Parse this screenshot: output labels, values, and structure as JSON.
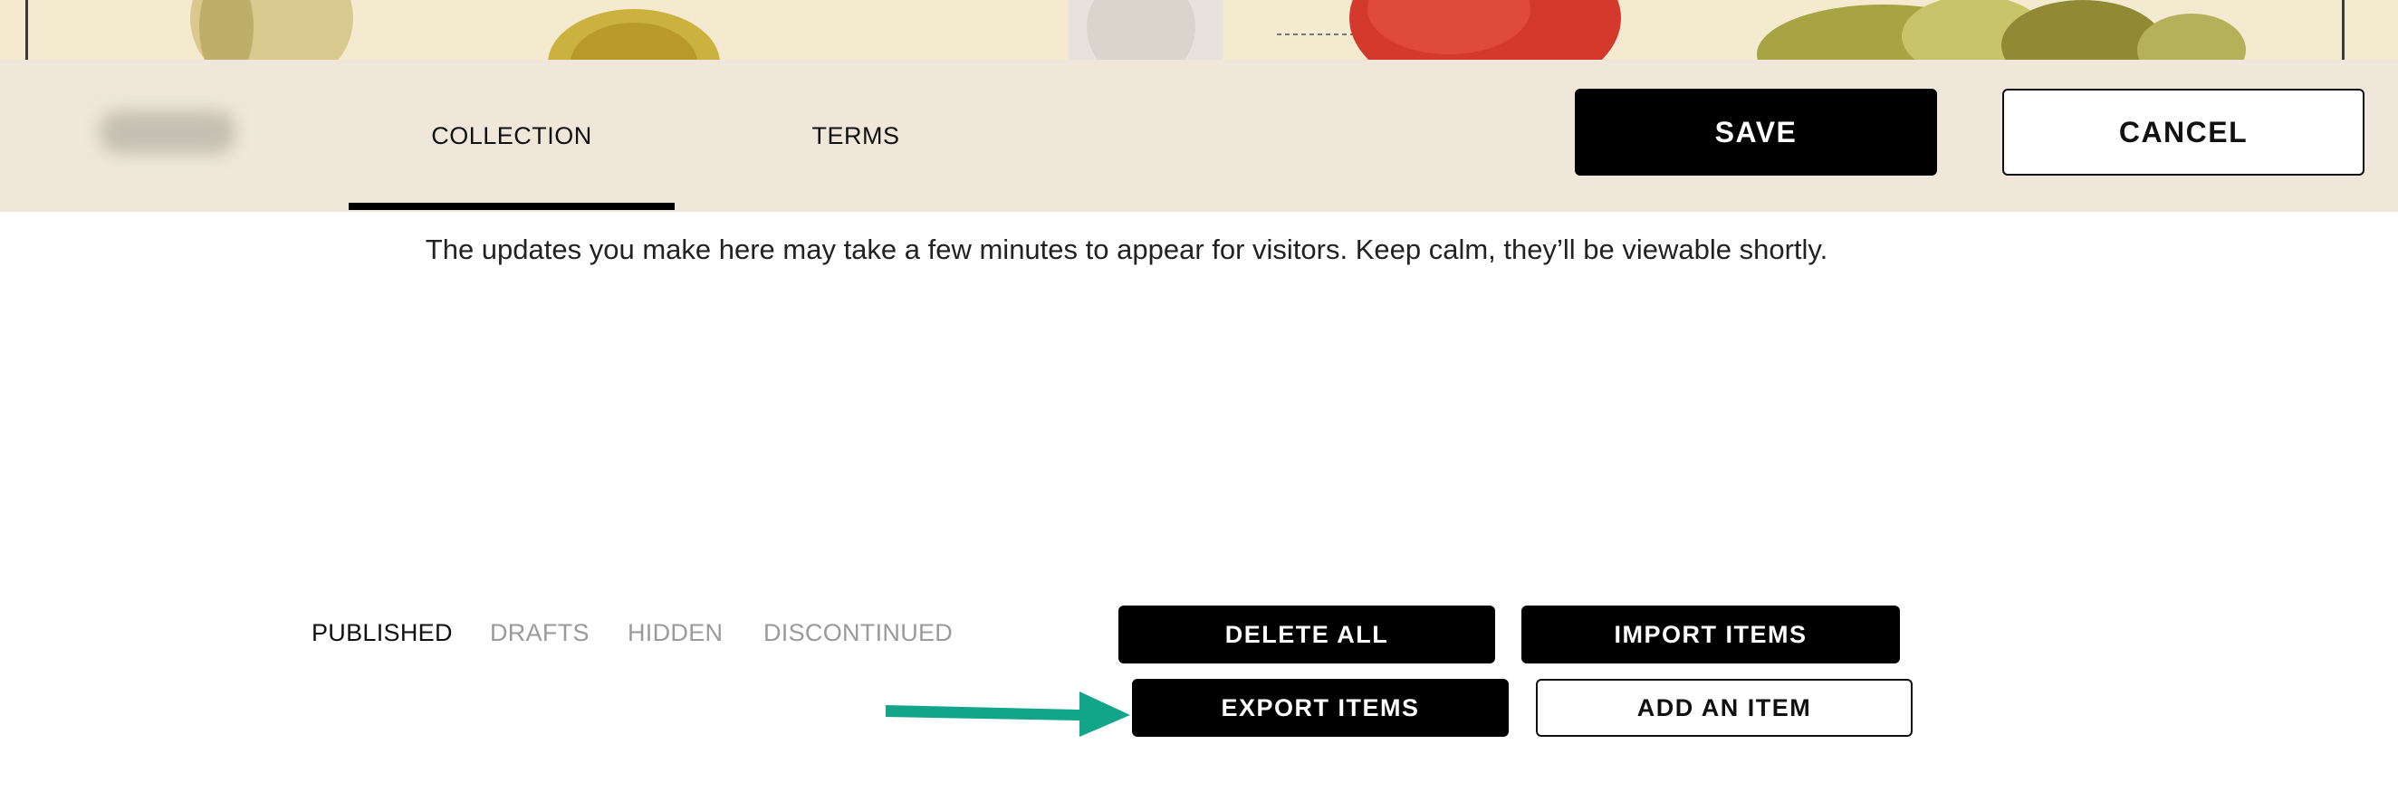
{
  "header": {
    "tabs": [
      {
        "label": "COLLECTION",
        "active": true
      },
      {
        "label": "TERMS",
        "active": false
      }
    ],
    "save_label": "SAVE",
    "cancel_label": "CANCEL"
  },
  "notice_text": "The updates you make here may take a few minutes to appear for visitors. Keep calm, they’ll be viewable shortly.",
  "filters": [
    {
      "label": "PUBLISHED",
      "active": true
    },
    {
      "label": "DRAFTS",
      "active": false
    },
    {
      "label": "HIDDEN",
      "active": false
    },
    {
      "label": "DISCONTINUED",
      "active": false
    }
  ],
  "actions": {
    "delete_all": "DELETE ALL",
    "import_items": "IMPORT ITEMS",
    "export_items": "EXPORT ITEMS",
    "add_item": "ADD AN ITEM"
  },
  "annotation": {
    "arrow_color": "#12a58a"
  },
  "colors": {
    "navbar_bg": "#efe8da",
    "button_dark": "#000000",
    "inactive_filter": "#9a9a9a"
  }
}
